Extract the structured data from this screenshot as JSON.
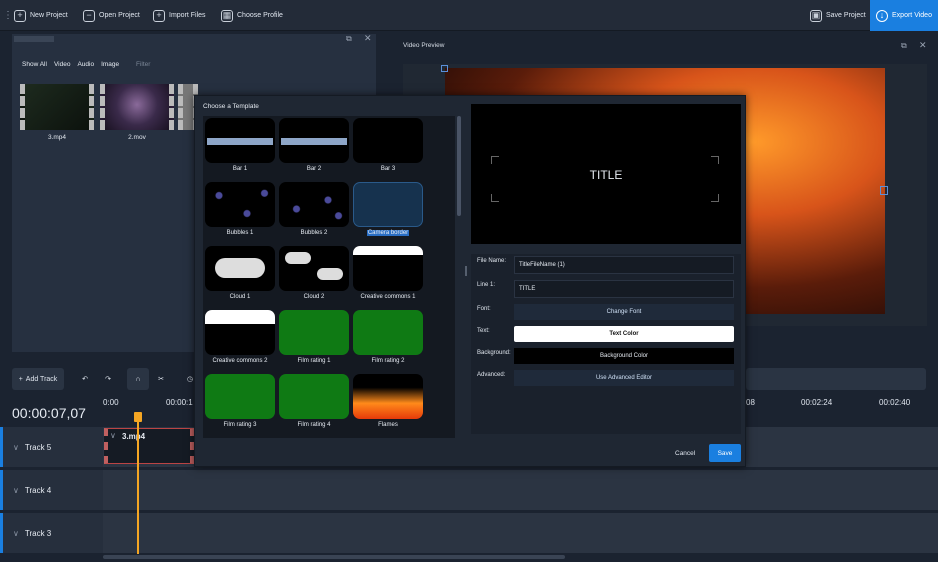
{
  "toolbar": {
    "new_project": "New Project",
    "open_project": "Open Project",
    "import_files": "Import Files",
    "choose_profile": "Choose Profile",
    "save_project": "Save Project",
    "export_video": "Export Video"
  },
  "media": {
    "tabs": [
      "Show All",
      "Video",
      "Audio",
      "Image"
    ],
    "filter_placeholder": "Filter",
    "files": [
      "3.mp4",
      "2.mov"
    ]
  },
  "preview": {
    "title": "Video Preview"
  },
  "timeline": {
    "add_track": "Add Track",
    "timecode": "00:00:07,07",
    "ticks": [
      "0:00",
      "00:00:1",
      "08",
      "00:02:24",
      "00:02:40"
    ],
    "tracks": [
      "Track 5",
      "Track 4",
      "Track 3"
    ],
    "clip_name": "3.mp4"
  },
  "modal": {
    "title": "Choose a Template",
    "templates": [
      "Bar 1",
      "Bar 2",
      "Bar 3",
      "Bubbles 1",
      "Bubbles 2",
      "Camera border",
      "Cloud 1",
      "Cloud 2",
      "Creative commons 1",
      "Creative commons 2",
      "Film rating 1",
      "Film rating 2",
      "Film rating 3",
      "Film rating 4",
      "Flames"
    ],
    "preview_title": "TITLE",
    "form": {
      "file_name_label": "File Name:",
      "file_name_value": "TitleFileName (1)",
      "line1_label": "Line 1:",
      "line1_value": "TITLE",
      "font_label": "Font:",
      "change_font": "Change Font",
      "text_label": "Text:",
      "text_color": "Text Color",
      "background_label": "Background:",
      "background_color": "Background Color",
      "advanced_label": "Advanced:",
      "advanced_editor": "Use Advanced Editor"
    },
    "cancel": "Cancel",
    "save": "Save"
  }
}
